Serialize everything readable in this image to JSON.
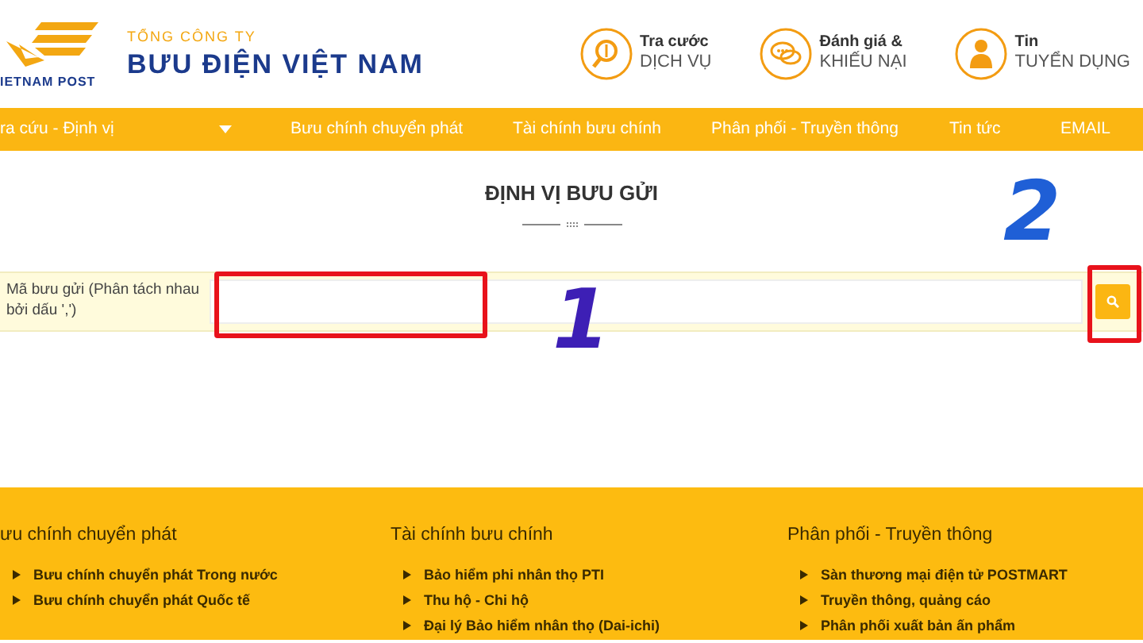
{
  "header": {
    "logo_caption": "IETNAM POST",
    "company_prefix": "TỔNG CÔNG TY",
    "company_name": "BƯU ĐIỆN VIỆT NAM",
    "quick_links": [
      {
        "kind": "fee",
        "line1": "Tra cước",
        "line2": "DỊCH VỤ"
      },
      {
        "kind": "chat",
        "line1": "Đánh giá &",
        "line2": "KHIẾU NẠI"
      },
      {
        "kind": "person",
        "line1": "Tin",
        "line2": "TUYỂN DỤNG"
      }
    ]
  },
  "nav": [
    {
      "label": "ra cứu - Định vị",
      "dropdown": true
    },
    {
      "label": "Bưu chính chuyển phát",
      "dropdown": false
    },
    {
      "label": "Tài chính bưu chính",
      "dropdown": false
    },
    {
      "label": "Phân phối - Truyền thông",
      "dropdown": false
    },
    {
      "label": "Tin tức",
      "dropdown": false
    },
    {
      "label": "EMAIL",
      "dropdown": false
    }
  ],
  "page_title": "ĐỊNH VỊ BƯU GỬI",
  "search": {
    "label": "Mã bưu gửi (Phân tách nhau bởi dấu ',')"
  },
  "annotations": [
    {
      "kind": "field",
      "number": "1",
      "color": "#3d1fb5"
    },
    {
      "kind": "button",
      "number": "2",
      "color": "#1f5fd6"
    }
  ],
  "footer": [
    {
      "heading": "ưu chính chuyển phát",
      "items": [
        "Bưu chính chuyển phát Trong nước",
        "Bưu chính chuyển phát Quốc tế"
      ]
    },
    {
      "heading": "Tài chính bưu chính",
      "items": [
        "Bảo hiểm phi nhân thọ PTI",
        "Thu hộ - Chi hộ",
        "Đại lý Bảo hiểm nhân thọ (Dai-ichi)"
      ]
    },
    {
      "heading": "Phân phối - Truyền thông",
      "items": [
        "Sàn thương mại điện tử POSTMART",
        "Truyền thông, quảng cáo",
        "Phân phối xuất bản ấn phẩm"
      ]
    }
  ]
}
